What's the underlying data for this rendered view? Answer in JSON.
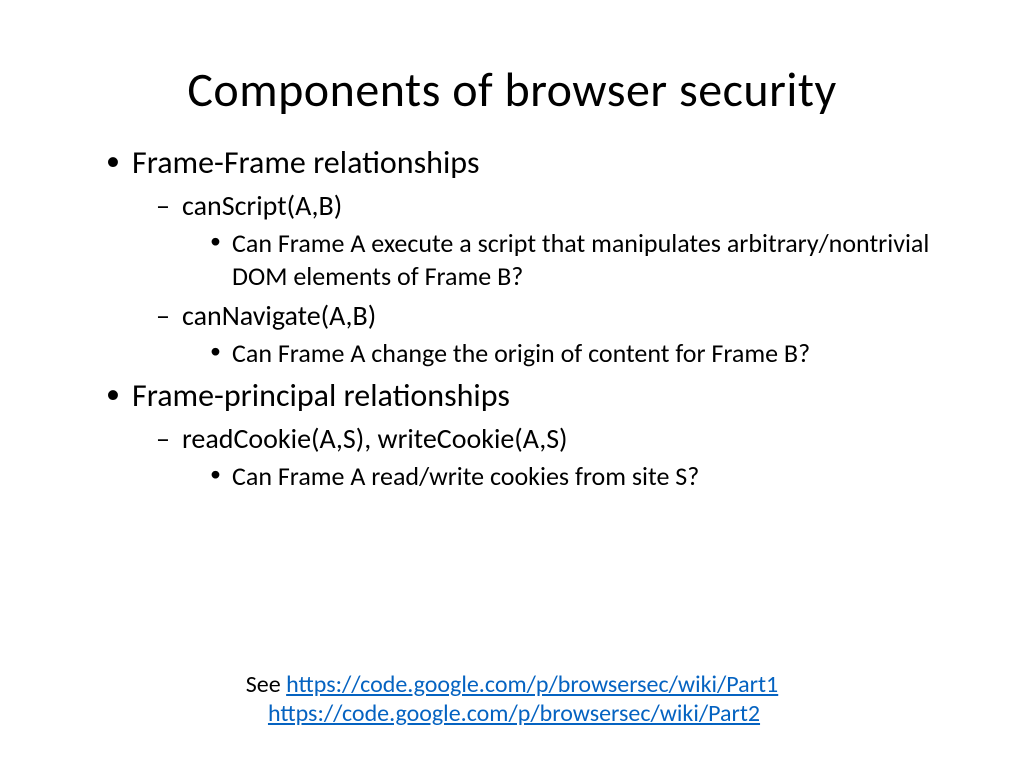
{
  "title": "Components of browser security",
  "bullets": {
    "item1": {
      "label": "Frame-Frame relationships",
      "sub1": {
        "label": "canScript(A,B)",
        "detail": "Can Frame A execute a script that manipulates arbitrary/nontrivial DOM elements of Frame B?"
      },
      "sub2": {
        "label": "canNavigate(A,B)",
        "detail": "Can Frame A change the origin of content for Frame B?"
      }
    },
    "item2": {
      "label": "Frame-principal relationships",
      "sub1": {
        "label": "readCookie(A,S), writeCookie(A,S)",
        "detail": "Can Frame A read/write cookies from site S?"
      }
    }
  },
  "footer": {
    "prefix": "See ",
    "link1_text": "https://code.google.com/p/browsersec/wiki/Part1",
    "link1_href": "https://code.google.com/p/browsersec/wiki/Part1",
    "link2_text": "https://code.google.com/p/browsersec/wiki/Part2",
    "link2_href": "https://code.google.com/p/browsersec/wiki/Part2"
  }
}
